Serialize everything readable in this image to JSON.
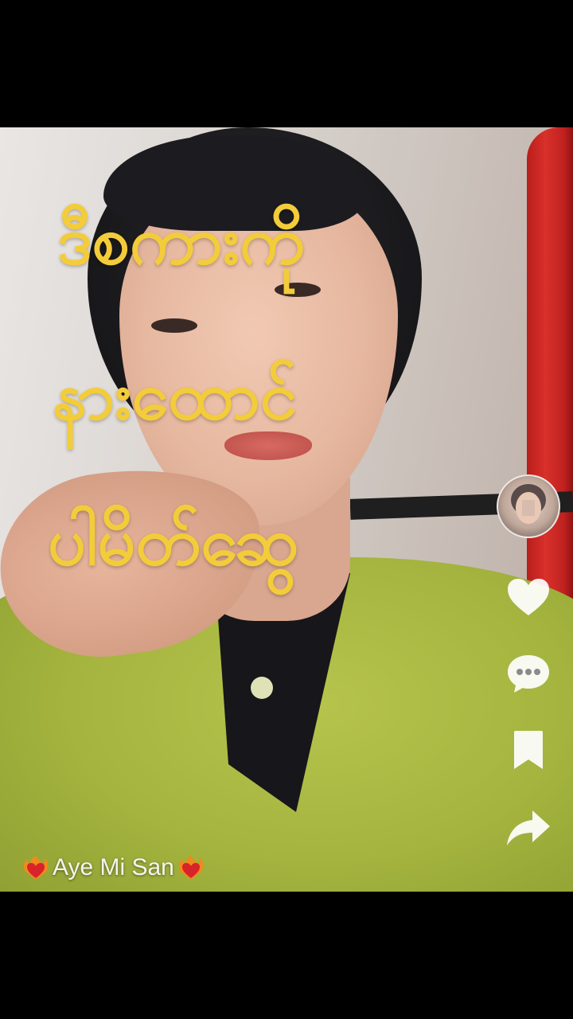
{
  "caption": {
    "line1": "ဒီစကားကို",
    "line2": "နားထောင်",
    "line3": "ပါမိတ်ဆွေ"
  },
  "creator": {
    "name": "Aye Mi San",
    "decoration_icon": "heart-on-fire-icon"
  },
  "actions": {
    "like_icon": "heart-icon",
    "comment_icon": "comment-bubble-icon",
    "save_icon": "bookmark-icon",
    "share_icon": "share-arrow-icon"
  },
  "colors": {
    "caption": "#f3cc3a",
    "background": "#000000",
    "icon": "#ffffff"
  }
}
